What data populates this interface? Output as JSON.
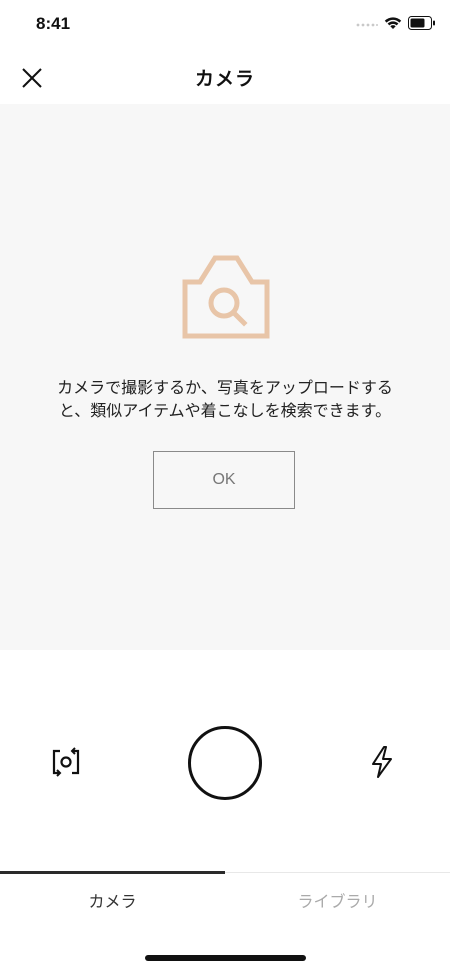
{
  "status_bar": {
    "time": "8:41",
    "icons": [
      "signal-icon",
      "wifi-icon",
      "battery-icon"
    ]
  },
  "header": {
    "title": "カメラ",
    "close_icon": "close-icon"
  },
  "main": {
    "illustration_icon": "camera-search-icon",
    "message_line1": "カメラで撮影するか、写真をアップロードする",
    "message_line2": "と、類似アイテムや着こなしを検索できます。",
    "ok_label": "OK"
  },
  "controls": {
    "flip_icon": "camera-flip-icon",
    "shutter_icon": "shutter-button",
    "flash_icon": "flash-icon"
  },
  "tabs": [
    {
      "label": "カメラ",
      "active": true
    },
    {
      "label": "ライブラリ",
      "active": false
    }
  ],
  "colors": {
    "accent_illustration": "#e8c5a8",
    "tab_inactive": "#aaaaaa",
    "panel_background": "#f7f7f7"
  }
}
